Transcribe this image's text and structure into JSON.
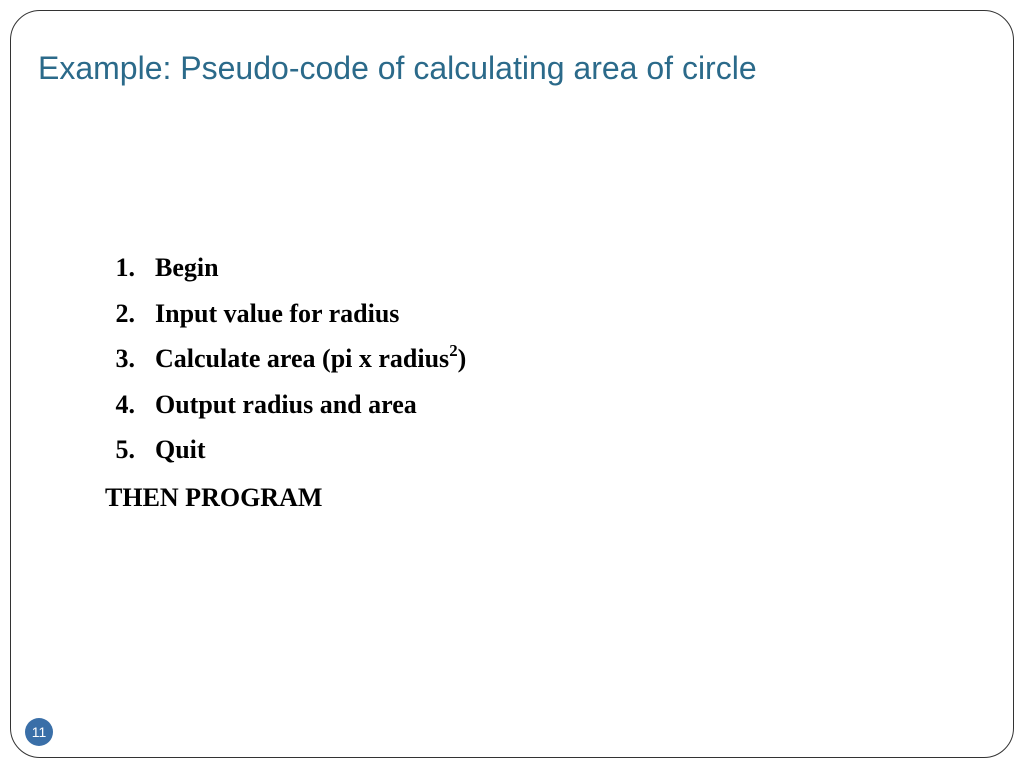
{
  "slide": {
    "title": "Example: Pseudo-code of calculating area of circle",
    "steps": [
      {
        "num": "1.",
        "text": "Begin"
      },
      {
        "num": "2.",
        "text": "Input value for radius"
      },
      {
        "num": "3.",
        "prefix": "Calculate area (pi x radius",
        "sup": "2",
        "suffix": ")"
      },
      {
        "num": "4.",
        "text": "Output radius and area"
      },
      {
        "num": "5.",
        "text": "Quit"
      }
    ],
    "footer": "THEN PROGRAM",
    "page_number": "11"
  }
}
